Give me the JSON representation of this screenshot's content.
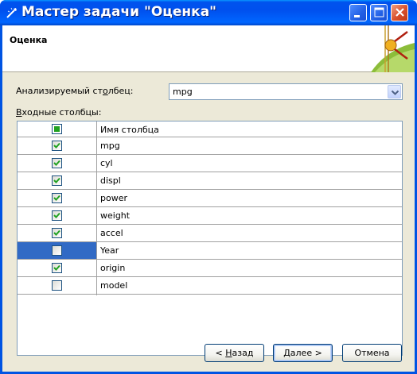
{
  "window": {
    "title": "Мастер задачи \"Оценка\""
  },
  "header": {
    "title": "Оценка"
  },
  "analyzed": {
    "label_pre": "Анализируемый ст",
    "label_accel": "о",
    "label_post": "лбец:",
    "value": "mpg"
  },
  "inputs": {
    "label_accel": "В",
    "label_post": "ходные столбцы:"
  },
  "grid": {
    "column_header": "Имя столбца",
    "rows": [
      {
        "name": "mpg",
        "checked": true
      },
      {
        "name": "cyl",
        "checked": true
      },
      {
        "name": "displ",
        "checked": true
      },
      {
        "name": "power",
        "checked": true
      },
      {
        "name": "weight",
        "checked": true
      },
      {
        "name": "accel",
        "checked": true
      },
      {
        "name": "Year",
        "checked": false,
        "selected": true
      },
      {
        "name": "origin",
        "checked": true
      },
      {
        "name": "model",
        "checked": false
      }
    ]
  },
  "buttons": {
    "back_pre": "< ",
    "back_accel": "Н",
    "back_post": "азад",
    "next_accel": "Д",
    "next_post": "алее >",
    "cancel": "Отмена"
  },
  "colors": {
    "titlebar": "#0054e3",
    "selection": "#316ac5",
    "check": "#21a121"
  }
}
